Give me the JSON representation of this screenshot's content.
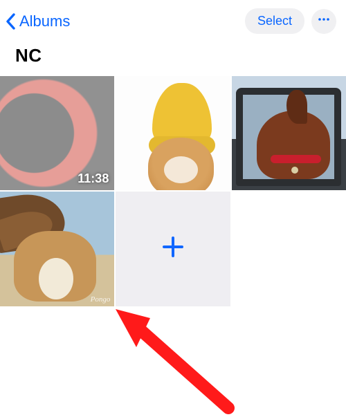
{
  "nav": {
    "back_label": "Albums",
    "select_label": "Select"
  },
  "album": {
    "title": "NC"
  },
  "grid": {
    "items": [
      {
        "kind": "video",
        "duration": "11:38"
      },
      {
        "kind": "photo"
      },
      {
        "kind": "photo"
      },
      {
        "kind": "photo",
        "watermark": "Pongo"
      },
      {
        "kind": "add"
      }
    ]
  },
  "colors": {
    "accent": "#0a66ff",
    "annotation_arrow": "#ff1a1a"
  }
}
